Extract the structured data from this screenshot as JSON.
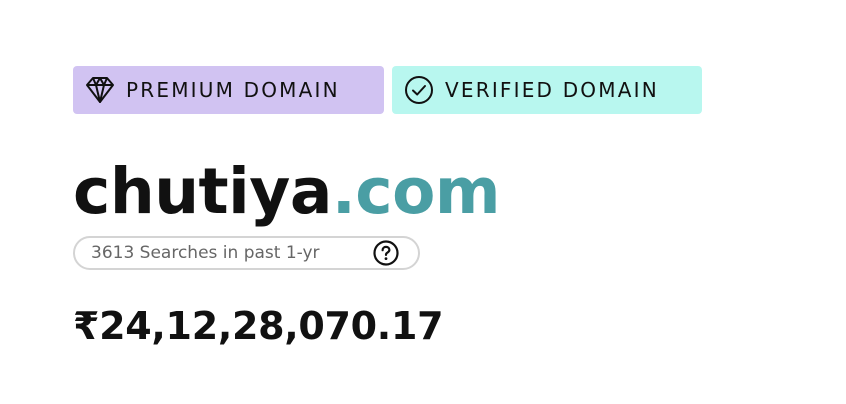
{
  "badges": {
    "premium": {
      "label": "PREMIUM DOMAIN",
      "icon": "diamond-icon",
      "color": "#d1c3f2"
    },
    "verified": {
      "label": "VERIFIED DOMAIN",
      "icon": "check-circle-icon",
      "color": "#b8f7ef"
    }
  },
  "domain": {
    "name": "chutiya",
    "tld": ".com",
    "tld_color": "#4a9ea4"
  },
  "searches": {
    "text": "3613 Searches in past 1-yr",
    "help_icon": "question-circle-icon"
  },
  "price": {
    "value": "₹24,12,28,070.17"
  }
}
